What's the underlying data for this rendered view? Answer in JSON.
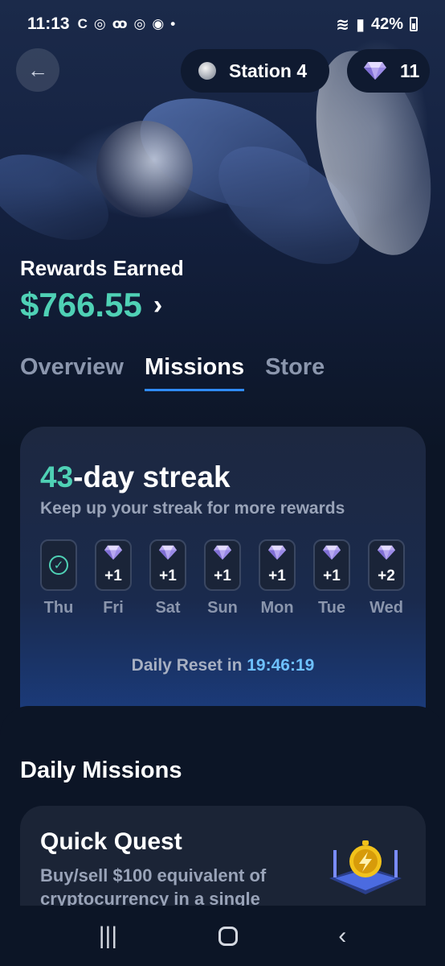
{
  "status_bar": {
    "time": "11:13",
    "left_icons": [
      "c-icon",
      "instagram-icon",
      "voicemail-icon",
      "instagram-icon",
      "app-icon",
      "dot"
    ],
    "battery": "42%"
  },
  "header": {
    "station_label": "Station 4",
    "gem_count": "11"
  },
  "rewards": {
    "label": "Rewards Earned",
    "amount": "$766.55",
    "amount_color": "#4fd1b5"
  },
  "tabs": [
    {
      "label": "Overview",
      "active": false
    },
    {
      "label": "Missions",
      "active": true
    },
    {
      "label": "Store",
      "active": false
    }
  ],
  "streak": {
    "count": "43",
    "title_suffix": "-day streak",
    "subtitle": "Keep up your streak for more rewards",
    "days": [
      {
        "label": "Thu",
        "reward": "",
        "completed": true
      },
      {
        "label": "Fri",
        "reward": "+1",
        "completed": false
      },
      {
        "label": "Sat",
        "reward": "+1",
        "completed": false
      },
      {
        "label": "Sun",
        "reward": "+1",
        "completed": false
      },
      {
        "label": "Mon",
        "reward": "+1",
        "completed": false
      },
      {
        "label": "Tue",
        "reward": "+1",
        "completed": false
      },
      {
        "label": "Wed",
        "reward": "+2",
        "completed": false
      }
    ],
    "reset_label": "Daily Reset in",
    "reset_time": "19:46:19"
  },
  "daily_missions": {
    "title": "Daily Missions",
    "quest": {
      "title": "Quick Quest",
      "description": "Buy/sell $100 equivalent of cryptocurrency in a single"
    }
  }
}
